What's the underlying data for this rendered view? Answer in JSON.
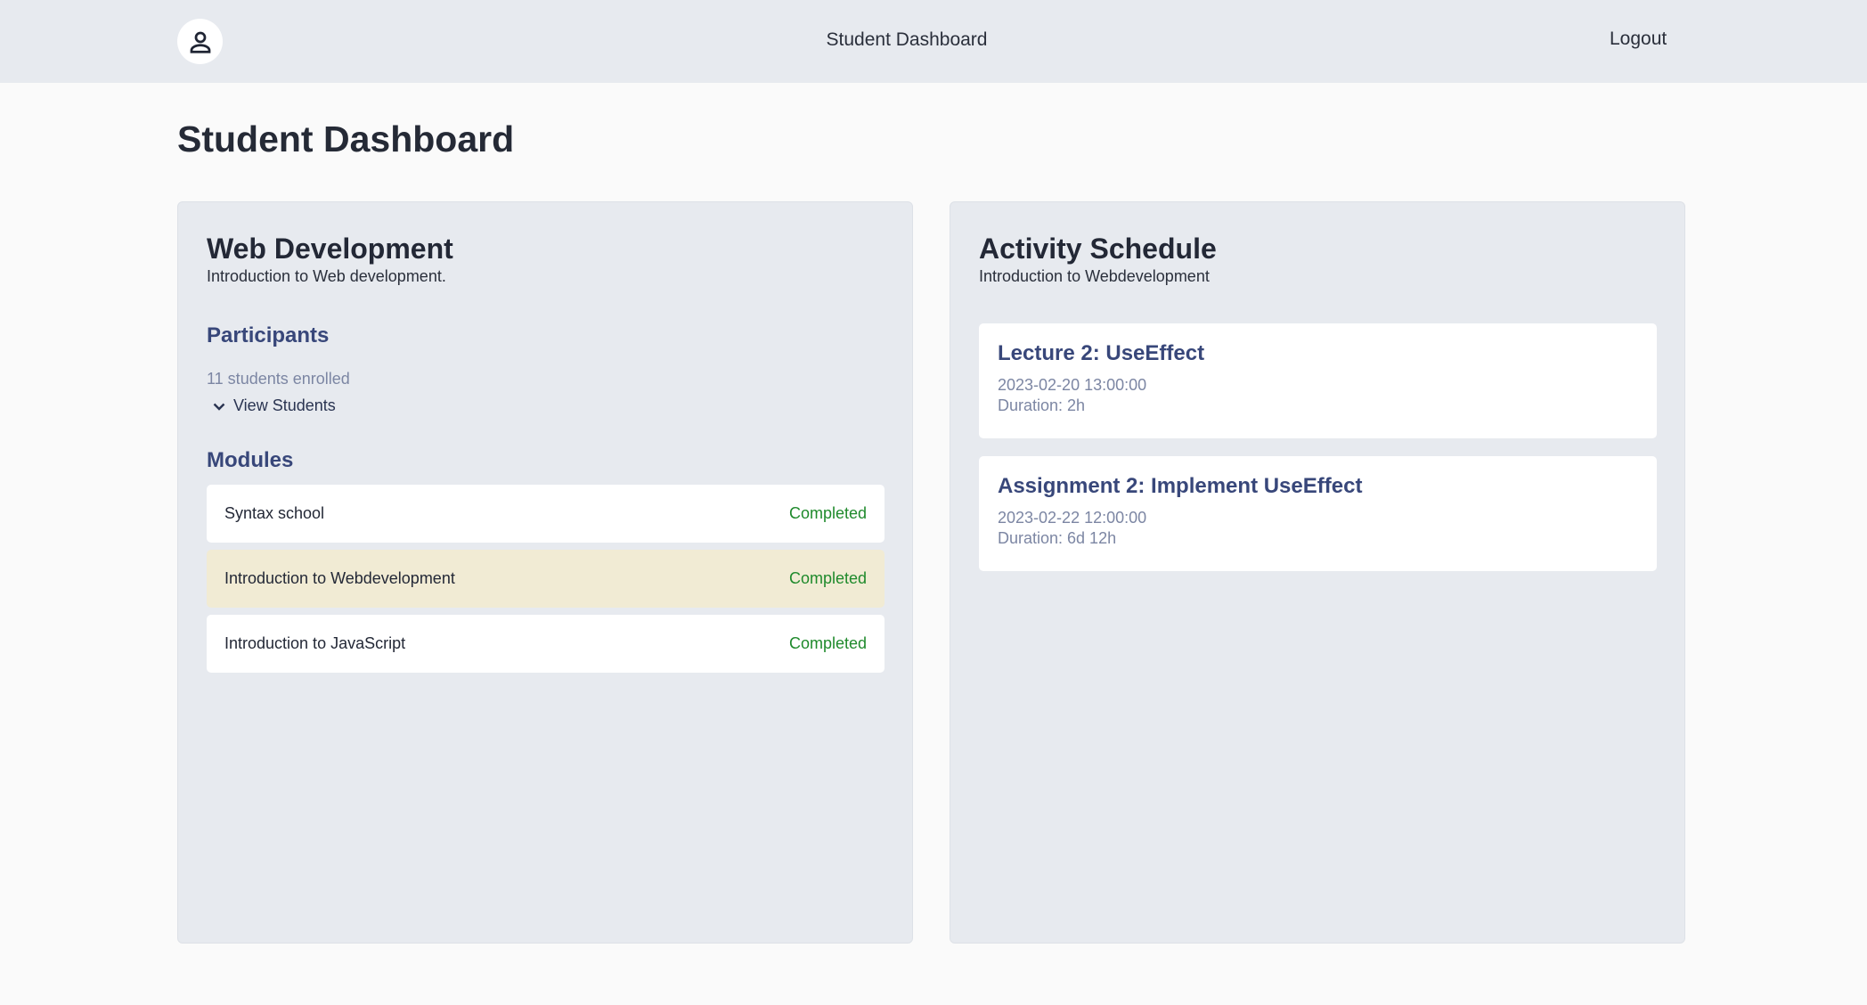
{
  "header": {
    "avatar_icon": "user-icon",
    "title": "Student Dashboard",
    "logout_label": "Logout"
  },
  "page": {
    "title": "Student Dashboard"
  },
  "course": {
    "title": "Web Development",
    "subtitle": "Introduction to Web development.",
    "participants_heading": "Participants",
    "enrolled_text": "11 students enrolled",
    "view_students_label": "View Students",
    "modules_heading": "Modules",
    "modules": [
      {
        "name": "Syntax school",
        "status": "Completed",
        "highlighted": false
      },
      {
        "name": "Introduction to Webdevelopment",
        "status": "Completed",
        "highlighted": true
      },
      {
        "name": "Introduction to JavaScript",
        "status": "Completed",
        "highlighted": false
      }
    ]
  },
  "schedule": {
    "title": "Activity Schedule",
    "subtitle": "Introduction to Webdevelopment",
    "events": [
      {
        "title": "Lecture 2: UseEffect",
        "date": "2023-02-20 13:00:00",
        "duration": "Duration: 2h"
      },
      {
        "title": "Assignment 2: Implement UseEffect",
        "date": "2023-02-22 12:00:00",
        "duration": "Duration: 6d 12h"
      }
    ]
  },
  "colors": {
    "status_completed": "#1f8a2c",
    "section_heading": "#38477a",
    "highlight_row": "#f1ebd4",
    "topbar_bg": "#e7eaef"
  }
}
